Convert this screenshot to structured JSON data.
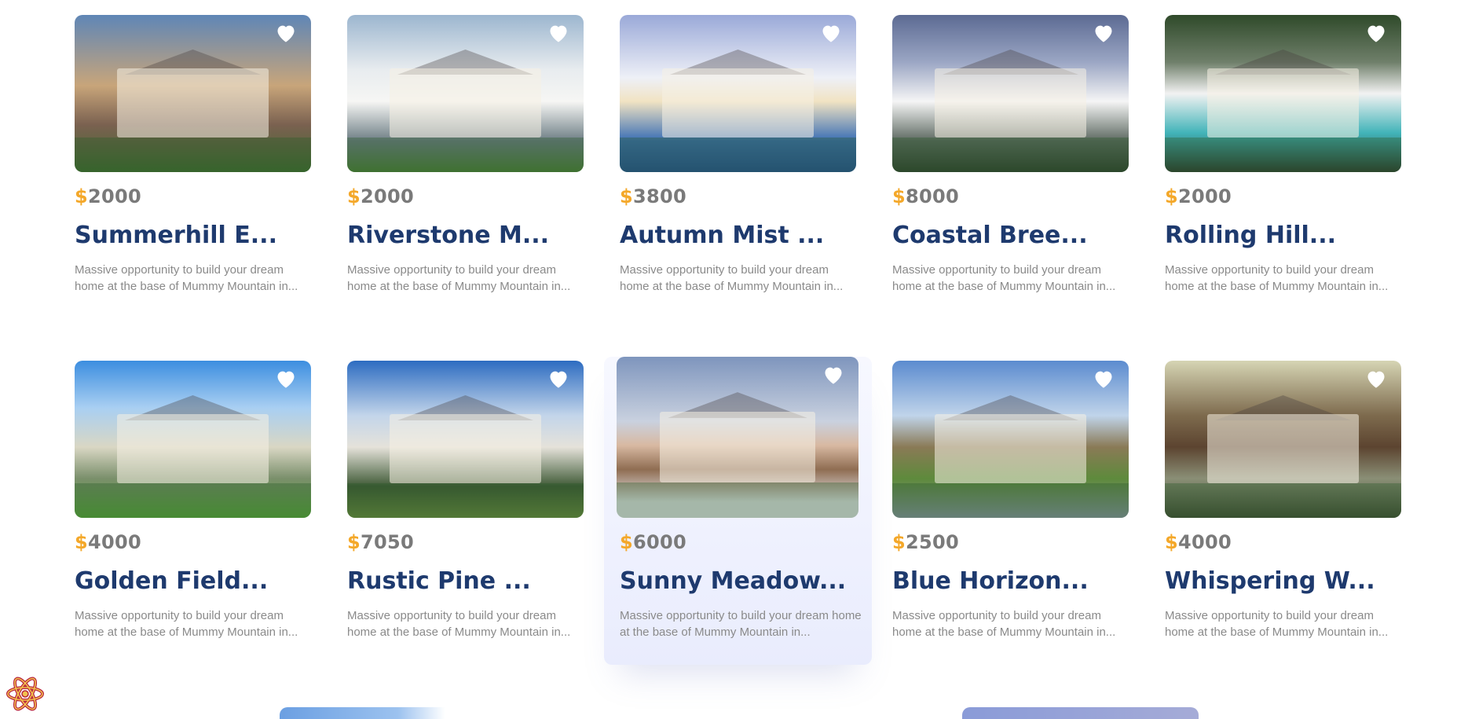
{
  "colors": {
    "price_currency": "#f4a82a",
    "price_amount": "#7a7a7a",
    "title": "#1e3a6e",
    "description": "#8a8a8a"
  },
  "listings": [
    {
      "currency": "$",
      "amount": "2000",
      "title": "Summerhill E...",
      "description": "Massive opportunity to build your dream home at the base of Mummy Mountain in..."
    },
    {
      "currency": "$",
      "amount": "2000",
      "title": "Riverstone M...",
      "description": "Massive opportunity to build your dream home at the base of Mummy Mountain in..."
    },
    {
      "currency": "$",
      "amount": "3800",
      "title": "Autumn Mist ...",
      "description": "Massive opportunity to build your dream home at the base of Mummy Mountain in..."
    },
    {
      "currency": "$",
      "amount": "8000",
      "title": "Coastal Bree...",
      "description": "Massive opportunity to build your dream home at the base of Mummy Mountain in..."
    },
    {
      "currency": "$",
      "amount": "2000",
      "title": "Rolling Hill...",
      "description": "Massive opportunity to build your dream home at the base of Mummy Mountain in..."
    },
    {
      "currency": "$",
      "amount": "4000",
      "title": "Golden Field...",
      "description": "Massive opportunity to build your dream home at the base of Mummy Mountain in..."
    },
    {
      "currency": "$",
      "amount": "7050",
      "title": "Rustic Pine ...",
      "description": "Massive opportunity to build your dream home at the base of Mummy Mountain in..."
    },
    {
      "currency": "$",
      "amount": "6000",
      "title": "Sunny Meadow...",
      "description": "Massive opportunity to build your dream home at the base of Mummy Mountain in..."
    },
    {
      "currency": "$",
      "amount": "2500",
      "title": "Blue Horizon...",
      "description": "Massive opportunity to build your dream home at the base of Mummy Mountain in..."
    },
    {
      "currency": "$",
      "amount": "4000",
      "title": "Whispering W...",
      "description": "Massive opportunity to build your dream home at the base of Mummy Mountain in..."
    }
  ],
  "icons": {
    "favorite": "heart-icon",
    "devtools": "react-icon"
  }
}
